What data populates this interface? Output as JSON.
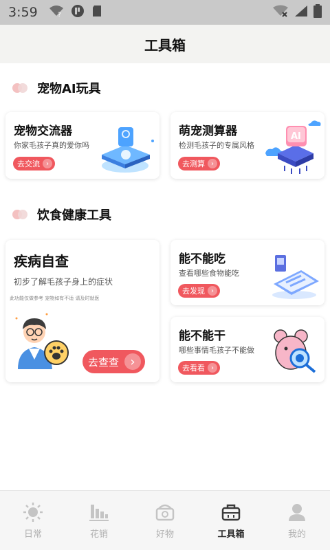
{
  "status": {
    "time": "3:59"
  },
  "page_title": "工具箱",
  "sections": [
    {
      "title": "宠物AI玩具"
    },
    {
      "title": "饮食健康工具"
    }
  ],
  "cards": {
    "pet_chat": {
      "title": "宠物交流器",
      "desc": "你家毛孩子真的爱你吗",
      "btn": "去交流"
    },
    "pet_calc": {
      "title": "萌宠测算器",
      "desc": "检测毛孩子的专属风格",
      "btn": "去测算"
    },
    "disease": {
      "title": "疾病自查",
      "desc": "初步了解毛孩子身上的症状",
      "note": "此功能仅做参考 宠物如有不适 请及时就医",
      "btn": "去查查"
    },
    "can_eat": {
      "title": "能不能吃",
      "desc": "查看哪些食物能吃",
      "btn": "去发现"
    },
    "can_do": {
      "title": "能不能干",
      "desc": "哪些事情毛孩子不能做",
      "btn": "去看看"
    }
  },
  "nav": [
    {
      "label": "日常",
      "icon": "sun-icon"
    },
    {
      "label": "花销",
      "icon": "bar-chart-icon"
    },
    {
      "label": "好物",
      "icon": "basket-icon"
    },
    {
      "label": "工具箱",
      "icon": "toolbox-icon",
      "active": true
    },
    {
      "label": "我的",
      "icon": "person-icon"
    }
  ],
  "colors": {
    "accent": "#f0585e",
    "active_nav": "#2b2b2b",
    "inactive_nav": "#b0b0b0"
  }
}
